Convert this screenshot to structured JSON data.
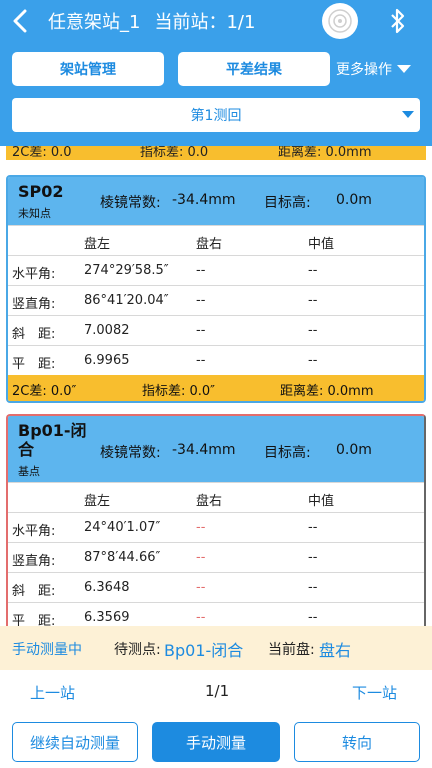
{
  "header": {
    "title": "任意架站_1",
    "station_indicator": "当前站：1/1"
  },
  "toolbar": {
    "station_manage": "架站管理",
    "adjust_result": "平差结果",
    "more_ops": "更多操作",
    "round_select": "第1测回"
  },
  "prev_card_footer": {
    "c2": "2C差: 0.0",
    "index": "指标差: 0.0",
    "dist": "距离差: 0.0mm"
  },
  "cards": [
    {
      "name": "SP02",
      "type": "未知点",
      "prism_label": "棱镜常数:",
      "prism_value": "-34.4mm",
      "target_height_label": "目标高:",
      "target_height_value": "0.0m",
      "col_headers": [
        "",
        "盘左",
        "盘右",
        "中值"
      ],
      "rows": [
        {
          "label": "水平角:",
          "left": "274°29′58.5″",
          "right": "--",
          "mid": "--"
        },
        {
          "label": "竖直角:",
          "left": "86°41′20.04″",
          "right": "--",
          "mid": "--"
        },
        {
          "label": "斜　距:",
          "left": "7.0082",
          "right": "--",
          "mid": "--"
        },
        {
          "label": "平　距:",
          "left": "6.9965",
          "right": "--",
          "mid": "--"
        }
      ],
      "footer": {
        "c2": "2C差: 0.0″",
        "index": "指标差: 0.0″",
        "dist": "距离差: 0.0mm"
      }
    },
    {
      "name": "Bp01-闭合",
      "type": "基点",
      "prism_label": "棱镜常数:",
      "prism_value": "-34.4mm",
      "target_height_label": "目标高:",
      "target_height_value": "0.0m",
      "col_headers": [
        "",
        "盘左",
        "盘右",
        "中值"
      ],
      "rows": [
        {
          "label": "水平角:",
          "left": "24°40′1.07″",
          "right": "--",
          "mid": "--"
        },
        {
          "label": "竖直角:",
          "left": "87°8′44.66″",
          "right": "--",
          "mid": "--"
        },
        {
          "label": "斜　距:",
          "left": "6.3648",
          "right": "--",
          "mid": "--"
        },
        {
          "label": "平　距:",
          "left": "6.3569",
          "right": "--",
          "mid": "--"
        }
      ]
    }
  ],
  "status": {
    "mode": "手动测量中",
    "pending_label": "待测点:",
    "pending_value": "Bp01-闭合",
    "face_label": "当前盘:",
    "face_value": "盘右"
  },
  "pager": {
    "prev": "上一站",
    "page": "1/1",
    "next": "下一站"
  },
  "actions": {
    "auto": "继续自动测量",
    "manual": "手动测量",
    "third": "转向"
  },
  "colors": {
    "accent": "#3aa0ea",
    "button_blue": "#1d8be0",
    "card_header": "#5db5ee",
    "footer_yellow": "#f8be2e",
    "status_bg": "#fdf1d6",
    "warn_red": "#e36d6d"
  },
  "icons": {
    "back": "chevron-left-icon",
    "connect": "round-connect-icon",
    "bluetooth": "bluetooth-icon",
    "dropdown": "triangle-down-icon"
  }
}
